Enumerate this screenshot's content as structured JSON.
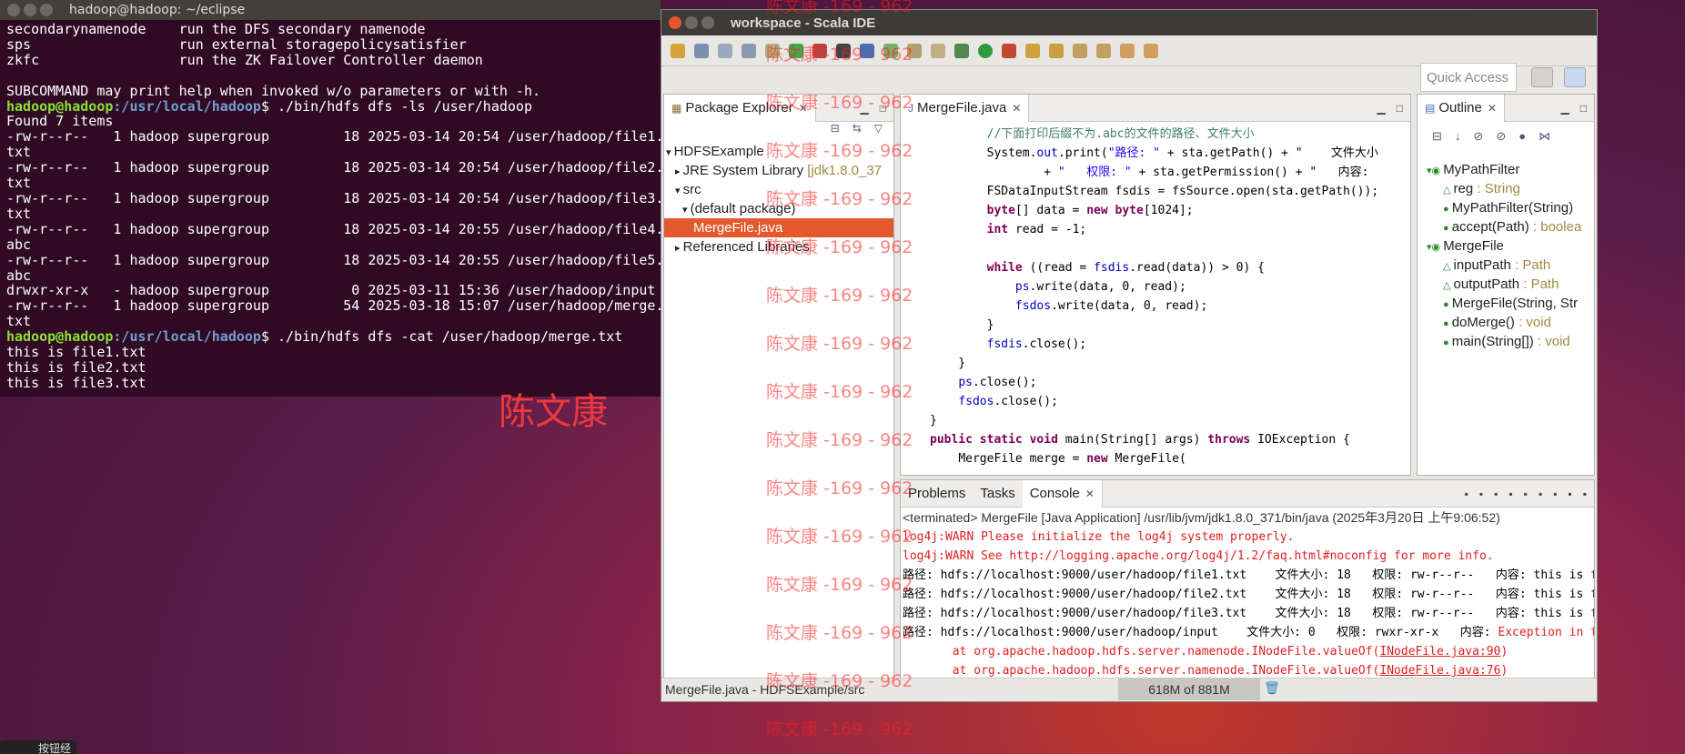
{
  "terminal": {
    "title": "hadoop@hadoop: ~/eclipse",
    "lines": [
      "secondarynamenode    run the DFS secondary namenode",
      "sps                  run external storagepolicysatisfier",
      "zkfc                 run the ZK Failover Controller daemon",
      "",
      "SUBCOMMAND may print help when invoked w/o parameters or with -h."
    ],
    "prompt_user": "hadoop@hadoop",
    "prompt_path": ":/usr/local/hadoop",
    "cmd1": "$ ./bin/hdfs dfs -ls /user/hadoop",
    "ls_output": [
      "Found 7 items",
      "-rw-r--r--   1 hadoop supergroup         18 2025-03-14 20:54 /user/hadoop/file1.",
      "txt",
      "-rw-r--r--   1 hadoop supergroup         18 2025-03-14 20:54 /user/hadoop/file2.",
      "txt",
      "-rw-r--r--   1 hadoop supergroup         18 2025-03-14 20:54 /user/hadoop/file3.",
      "txt",
      "-rw-r--r--   1 hadoop supergroup         18 2025-03-14 20:55 /user/hadoop/file4.",
      "abc",
      "-rw-r--r--   1 hadoop supergroup         18 2025-03-14 20:55 /user/hadoop/file5.",
      "abc",
      "drwxr-xr-x   - hadoop supergroup          0 2025-03-11 15:36 /user/hadoop/input",
      "-rw-r--r--   1 hadoop supergroup         54 2025-03-18 15:07 /user/hadoop/merge.",
      "txt"
    ],
    "cmd2": "$ ./bin/hdfs dfs -cat /user/hadoop/merge.txt",
    "cat_output": [
      "this is file1.txt",
      "this is file2.txt",
      "this is file3.txt"
    ]
  },
  "ide": {
    "title": "workspace - Scala IDE",
    "quick_access": "Quick Access",
    "package_explorer": {
      "tab": "Package Explorer",
      "items": [
        {
          "label": "HDFSExample",
          "extra": ""
        },
        {
          "label": "JRE System Library",
          "extra": "[jdk1.8.0_37"
        },
        {
          "label": "src",
          "extra": ""
        },
        {
          "label": "(default package)",
          "extra": ""
        },
        {
          "label": "MergeFile.java",
          "extra": ""
        },
        {
          "label": "Referenced Libraries",
          "extra": ""
        }
      ]
    },
    "editor": {
      "tab": "MergeFile.java",
      "lines": [
        "        //下面打印后缀不为.abc的文件的路径、文件大小",
        "        System.out.print(\"路径: \" + sta.getPath() + \"    文件大小",
        "                + \"   权限: \" + sta.getPermission() + \"   内容:",
        "        FSDataInputStream fsdis = fsSource.open(sta.getPath());",
        "        byte[] data = new byte[1024];",
        "        int read = -1;",
        "",
        "        while ((read = fsdis.read(data)) > 0) {",
        "            ps.write(data, 0, read);",
        "            fsdos.write(data, 0, read);",
        "        }",
        "        fsdis.close();",
        "    }",
        "    ps.close();",
        "    fsdos.close();",
        "}",
        "public static void main(String[] args) throws IOException {",
        "    MergeFile merge = new MergeFile("
      ]
    },
    "outline": {
      "tab": "Outline",
      "items": [
        {
          "name": "MyPathFilter",
          "type": ""
        },
        {
          "name": "reg",
          "type": " : String"
        },
        {
          "name": "MyPathFilter(String)",
          "type": ""
        },
        {
          "name": "accept(Path)",
          "type": " : boolea"
        },
        {
          "name": "MergeFile",
          "type": ""
        },
        {
          "name": "inputPath",
          "type": " : Path"
        },
        {
          "name": "outputPath",
          "type": " : Path"
        },
        {
          "name": "MergeFile(String, Str",
          "type": ""
        },
        {
          "name": "doMerge()",
          "type": " : void"
        },
        {
          "name": "main(String[])",
          "type": " : void"
        }
      ]
    },
    "bottom_tabs": [
      "Problems",
      "Tasks",
      "Console"
    ],
    "console": {
      "header": "<terminated> MergeFile [Java Application] /usr/lib/jvm/jdk1.8.0_371/bin/java (2025年3月20日 上午9:06:52)",
      "lines": [
        {
          "t": "log4j:WARN Please initialize the log4j system properly.",
          "c": "err"
        },
        {
          "t": "log4j:WARN See http://logging.apache.org/log4j/1.2/faq.html#noconfig for more info.",
          "c": "err"
        },
        {
          "t": "路径: hdfs://localhost:9000/user/hadoop/file1.txt    文件大小: 18   权限: rw-r--r--   内容: this is f",
          "c": ""
        },
        {
          "t": "路径: hdfs://localhost:9000/user/hadoop/file2.txt    文件大小: 18   权限: rw-r--r--   内容: this is f",
          "c": ""
        },
        {
          "t": "路径: hdfs://localhost:9000/user/hadoop/file3.txt    文件大小: 18   权限: rw-r--r--   内容: this is f",
          "c": ""
        },
        {
          "t": "路径: hdfs://localhost:9000/user/hadoop/input    文件大小: 0   权限: rwxr-xr-x   内容: ",
          "c": "",
          "e": "Exception in t"
        }
      ],
      "trace": [
        {
          "pre": "\tat org.apache.hadoop.hdfs.server.namenode.INodeFile.valueOf(",
          "link": "INodeFile.java:90",
          "post": ")"
        },
        {
          "pre": "\tat org.apache.hadoop.hdfs.server.namenode.INodeFile.valueOf(",
          "link": "INodeFile.java:76",
          "post": ")"
        }
      ]
    },
    "status_left": "MergeFile.java - HDFSExample/src",
    "heap": "618M of 881M"
  },
  "watermark": {
    "small": "陈文康 -169 - 962",
    "big": "陈文康"
  },
  "taskbar_label": "按钮经"
}
